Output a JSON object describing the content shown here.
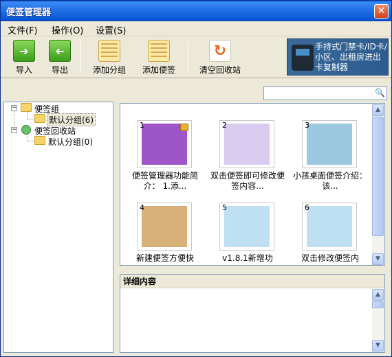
{
  "window": {
    "title": "便签管理器"
  },
  "menu": [
    {
      "label": "文件(F)"
    },
    {
      "label": "操作(O)"
    },
    {
      "label": "设置(S)"
    }
  ],
  "toolbar": {
    "import": "导入",
    "export": "导出",
    "add_group": "添加分组",
    "add_note": "添加便签",
    "clear_recycle": "清空回收站"
  },
  "ad": {
    "text": "手持式门禁卡/ID卡/小区、出租房进出卡复制器"
  },
  "search": {
    "value": "",
    "placeholder": ""
  },
  "tree": {
    "groups_root": "便签组",
    "groups_default": "默认分组(6)",
    "recycle_root": "便签回收站",
    "recycle_default": "默认分组(0)"
  },
  "notes": [
    {
      "num": "1",
      "caption": "便签管理器功能简介： 1.添...",
      "color": "#9e55c8",
      "locked": true
    },
    {
      "num": "2",
      "caption": "双击便签即可修改便签内容...",
      "color": "#d9ccf0",
      "locked": false
    },
    {
      "num": "3",
      "caption": "小孩桌面便签介绍： 该...",
      "color": "#9cc8e0",
      "locked": false
    },
    {
      "num": "4",
      "caption": "新建便签方便快",
      "color": "#d8b07a",
      "locked": false
    },
    {
      "num": "5",
      "caption": "v1.8.1新增功",
      "color": "#bfe0f2",
      "locked": false
    },
    {
      "num": "6",
      "caption": "双击修改便签内",
      "color": "#bfe0f2",
      "locked": false
    }
  ],
  "detail": {
    "title": "详细内容",
    "content": ""
  },
  "colors": {
    "titlebar": "#0a58d6",
    "frame": "#ece9d8",
    "panel_border": "#7f9db9"
  }
}
